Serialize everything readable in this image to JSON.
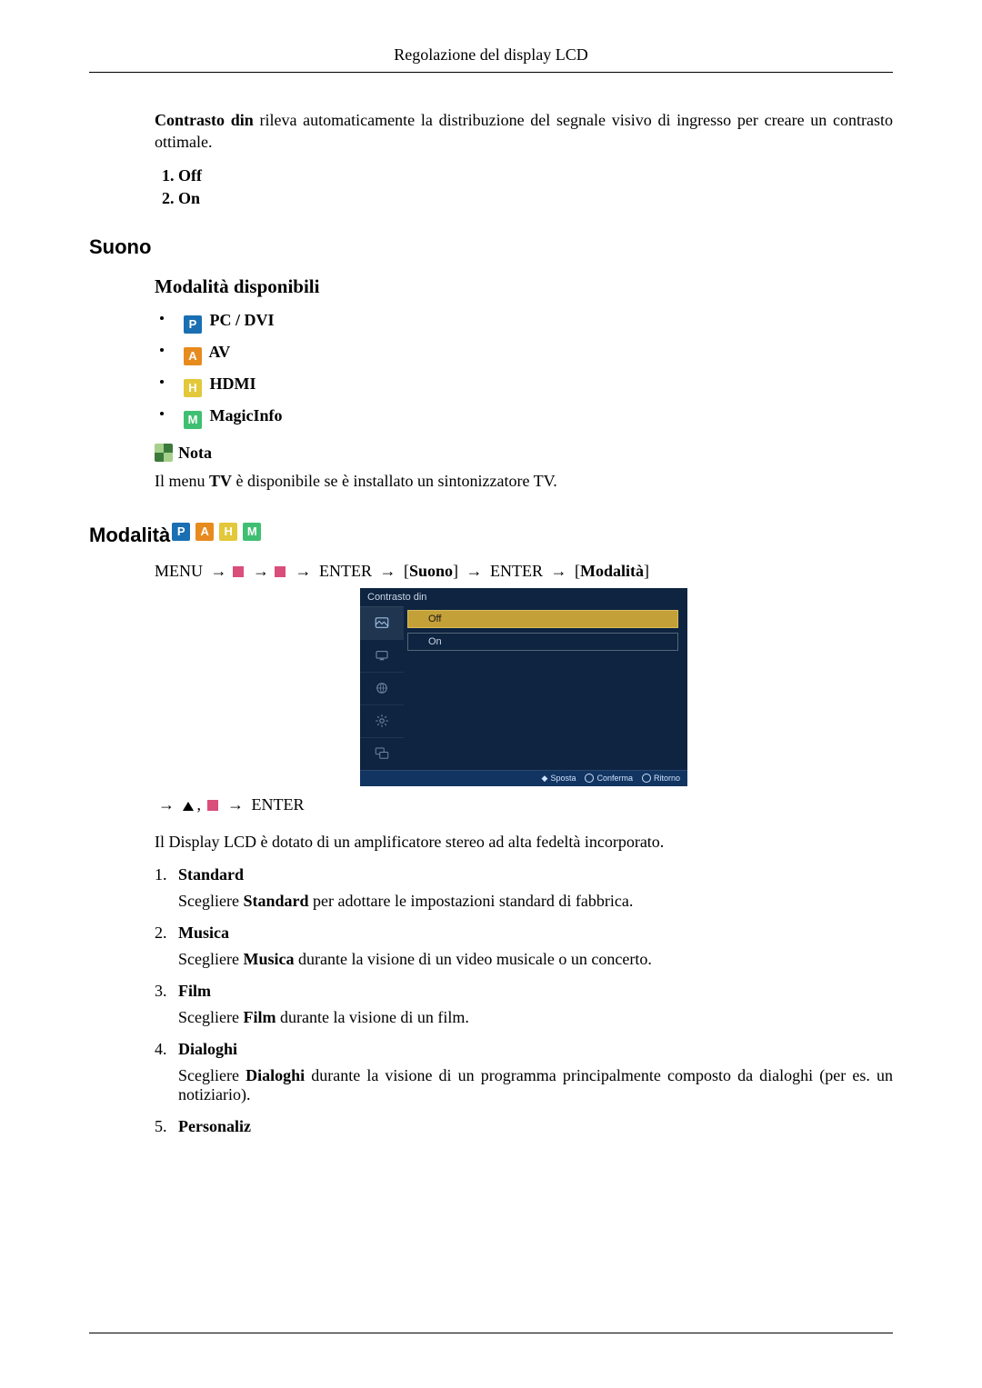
{
  "header": {
    "title": "Regolazione del display LCD"
  },
  "intro": {
    "strong": "Contrasto din",
    "rest": " rileva automaticamente la distribuzione del segnale visivo di ingresso per creare un contrasto ottimale."
  },
  "offon": {
    "off": "Off",
    "on": "On"
  },
  "sound_section": "Suono",
  "modes_title": "Modalità disponibili",
  "modes": {
    "pc": {
      "badge": "P",
      "label": "PC / DVI"
    },
    "av": {
      "badge": "A",
      "label": "AV"
    },
    "hdmi": {
      "badge": "H",
      "label": "HDMI"
    },
    "magic": {
      "badge": "M",
      "label": "MagicInfo"
    }
  },
  "note": {
    "label": "Nota",
    "text_pre": "Il menu ",
    "text_bold": "TV",
    "text_post": " è disponibile se è installato un sintonizzatore TV."
  },
  "modalita_section": "Modalità",
  "navpath": {
    "menu": "MENU",
    "arrow": "→",
    "enter": "ENTER",
    "suono": "Suono",
    "modalita": "Modalità"
  },
  "osd": {
    "title": "Contrasto din",
    "opt_off": "Off",
    "opt_on": "On",
    "footer": {
      "sposta": "Sposta",
      "conferma": "Conferma",
      "ritorno": "Ritorno"
    }
  },
  "after_osd_enter": "ENTER",
  "amp_text": "Il Display LCD è dotato di un amplificatore stereo ad alta fedeltà incorporato.",
  "entries": [
    {
      "num": "1.",
      "label": "Standard",
      "desc_pre": "Scegliere ",
      "desc_bold": "Standard",
      "desc_post": " per adottare le impostazioni standard di fabbrica."
    },
    {
      "num": "2.",
      "label": "Musica",
      "desc_pre": "Scegliere ",
      "desc_bold": "Musica",
      "desc_post": " durante la visione di un video musicale o un concerto."
    },
    {
      "num": "3.",
      "label": "Film",
      "desc_pre": "Scegliere ",
      "desc_bold": "Film",
      "desc_post": " durante la visione di un film."
    },
    {
      "num": "4.",
      "label": "Dialoghi",
      "desc_pre": "Scegliere ",
      "desc_bold": "Dialoghi",
      "desc_post": " durante la visione di un programma principalmente composto da dialoghi (per es. un notiziario)."
    },
    {
      "num": "5.",
      "label": "Personaliz",
      "desc_pre": "",
      "desc_bold": "",
      "desc_post": ""
    }
  ]
}
